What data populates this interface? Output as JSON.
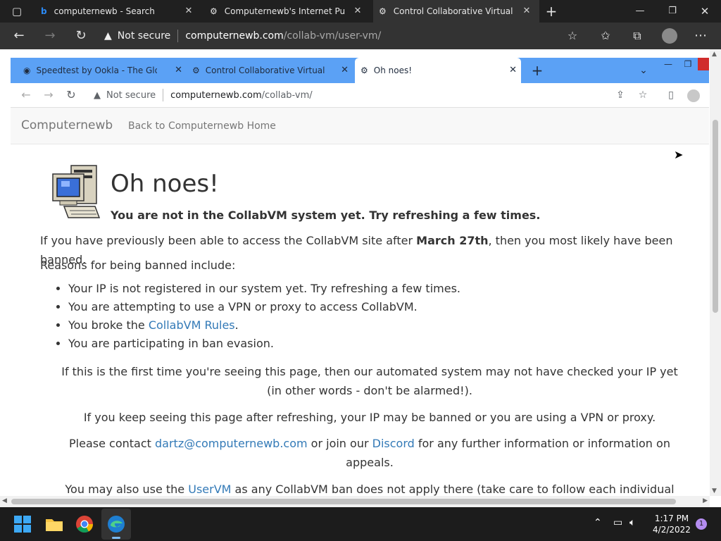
{
  "edge": {
    "tabs": [
      {
        "title": "computernewb - Search"
      },
      {
        "title": "Computernewb's Internet Pub H"
      },
      {
        "title": "Control Collaborative Virtual Ma"
      }
    ],
    "address": {
      "security": "Not secure",
      "host": "computernewb.com",
      "path": "/collab-vm/user-vm/"
    }
  },
  "chrome": {
    "tabs": [
      {
        "title": "Speedtest by Ookla - The Global"
      },
      {
        "title": "Control Collaborative Virtual Ma"
      },
      {
        "title": "Oh noes!"
      }
    ],
    "address": {
      "security": "Not secure",
      "host": "computernewb.com",
      "path": "/collab-vm/"
    }
  },
  "page": {
    "brand": "Computernewb",
    "nav_link": "Back to Computernewb Home",
    "title": "Oh noes!",
    "lead": "You are not in the CollabVM system yet. Try refreshing a few times.",
    "p1_before": "If you have previously been able to access the CollabVM site after ",
    "p1_bold": "March 27th",
    "p1_after": ", then you most likely have been banned.",
    "reasons_intro": "Reasons for being banned include:",
    "reasons": [
      "Your IP is not registered in our system yet. Try refreshing a few times.",
      "You are attempting to use a VPN or proxy to access CollabVM.",
      "You broke the ",
      "You are participating in ban evasion."
    ],
    "rules_link": "CollabVM Rules",
    "rules_after": ".",
    "p2_line1": "If this is the first time you're seeing this page, then our automated system may not have checked your IP yet",
    "p2_line2": "(in other words - don't be alarmed!).",
    "p3": "If you keep seeing this page after refreshing, your IP may be banned or you are using a VPN or proxy.",
    "p4_before": "Please contact ",
    "p4_email": "dartz@computernewb.com",
    "p4_mid": " or join our ",
    "p4_discord": "Discord",
    "p4_after": " for any further information or information on",
    "p4_line2": "appeals.",
    "p5_before": "You may also use the ",
    "p5_link": "UserVM",
    "p5_after": " as any CollabVM ban does not apply there (take care to follow each individual"
  },
  "taskbar": {
    "time": "1:17 PM",
    "date": "4/2/2022",
    "notifications": "1"
  },
  "colors": {
    "chrome_tabstrip": "#5ba1f5",
    "link": "#337ab7",
    "edge_dark": "#202020"
  }
}
